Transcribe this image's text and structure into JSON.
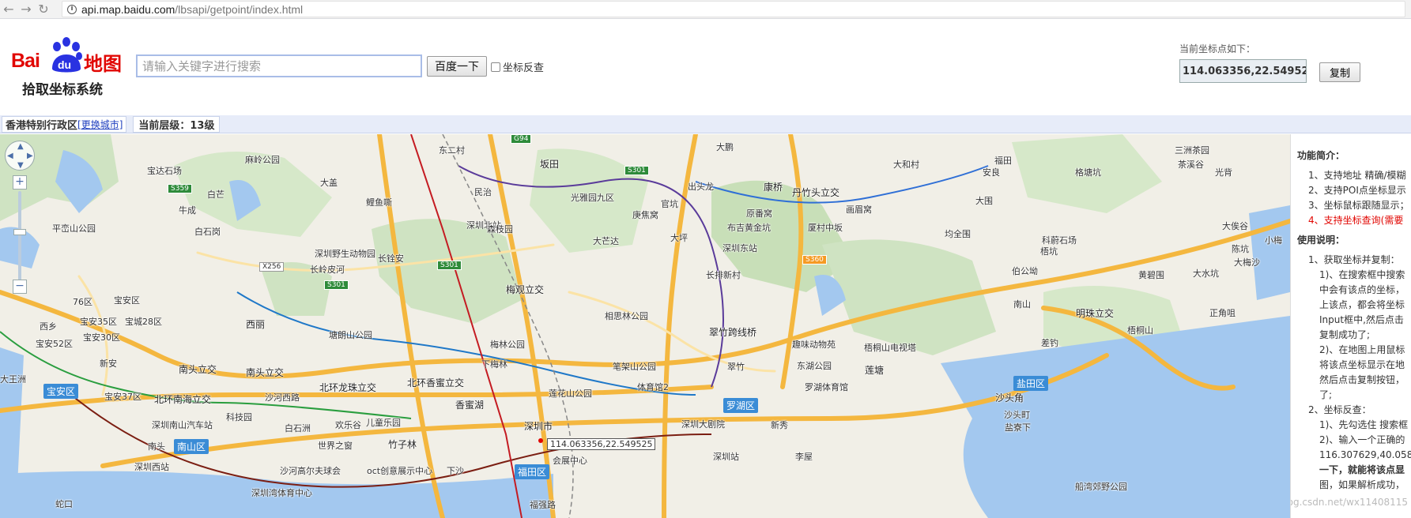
{
  "browser": {
    "url_host": "api.map.baidu.com",
    "url_path": "/lbsapi/getpoint/index.html"
  },
  "header": {
    "logo_text_bai": "Bai",
    "logo_text_du": "du",
    "logo_text_map": "地图",
    "logo_subtitle": "拾取坐标系统",
    "search_placeholder": "请输入关键字进行搜索",
    "search_button": "百度一下",
    "reverse_label": "坐标反查",
    "coord_title": "当前坐标点如下：",
    "coord_value": "114.063356,22.549525",
    "copy_button": "复制"
  },
  "citybar": {
    "city": "香港特别行政区",
    "change_city": "[更换城市]",
    "level": "当前层级：13级"
  },
  "map": {
    "popup_coord": "114.063356,22.549525",
    "districts": [
      "宝安区",
      "南山区",
      "罗湖区",
      "福田区",
      "盐田区"
    ],
    "road_tags": [
      "G94",
      "S301",
      "S359",
      "S301",
      "S301",
      "X256",
      "S360"
    ],
    "labels": [
      "麻岭公园",
      "东二村",
      "坂田",
      "大鹏",
      "福田",
      "三洲茶园",
      "宝达石场",
      "大盖",
      "民治",
      "光雅园九区",
      "出头龙",
      "康桥",
      "丹竹头立交",
      "大和村",
      "安良",
      "格塘坑",
      "光背",
      "茶溪谷",
      "白芒",
      "鲤鱼嘶",
      "深圳北站",
      "官坑",
      "原番窝",
      "画眉窝",
      "大围",
      "牛成",
      "森枝园",
      "庚焦窝",
      "布吉黄金坑",
      "厦村中坂",
      "均全围",
      "大俟谷",
      "平峦山公园",
      "白石岗",
      "大芒达",
      "大坪",
      "深圳东站",
      "科蔚石场",
      "陈坑",
      "小梅",
      "深圳野生动物园",
      "长岭皮河",
      "长铨安",
      "长排新村",
      "梧坑",
      "伯公坳",
      "黄碧围",
      "大水坑",
      "大梅沙",
      "76区",
      "宝安区",
      "梅观立交",
      "南山",
      "正角咀",
      "西丽",
      "相思林公园",
      "塘朗山公园",
      "西乡",
      "宝安35区",
      "宝城28区",
      "宝安30区",
      "翠竹跨线桥",
      "趣味动物苑",
      "梧桐山电视塔",
      "梧桐山",
      "明珠立交",
      "宝安52区",
      "梅林公园",
      "下梅林",
      "笔架山公园",
      "东湖公园",
      "莲塘",
      "差钓",
      "新安",
      "南头立交",
      "南头立交",
      "翠竹",
      "大王洲",
      "宝安37区",
      "北环南海立交",
      "北环龙珠立交",
      "北环香蜜立交",
      "体育馆2",
      "莲花山公园",
      "罗湖体育馆",
      "沙头角",
      "沙头町",
      "盐寮下",
      "深圳南山汽车站",
      "科技园",
      "白石洲",
      "欢乐谷",
      "儿童乐园",
      "香蜜湖",
      "深圳市",
      "深圳大剧院",
      "新秀",
      "南头",
      "世界之窗",
      "竹子林",
      "深圳西站",
      "沙河高尔夫球会",
      "oct创意展示中心",
      "下沙",
      "会展中心",
      "深圳站",
      "李屋",
      "深圳湾体育中心",
      "福强路",
      "船湾郊野公园",
      "蛇口",
      "沙河西路"
    ]
  },
  "panel": {
    "intro_title": "功能简介：",
    "intro_items": [
      "1、支持地址 精确/模糊",
      "2、支持POI点坐标显示",
      "3、坐标鼠标跟随显示；",
      "4、支持坐标查询(需要"
    ],
    "usage_title": "使用说明：",
    "usage_lines": [
      "1、获取坐标并复制：",
      "1)、在搜索框中搜索",
      "中会有该点的坐标，",
      "上该点，都会将坐标",
      "Input框中,然后点击",
      "复制成功了;",
      "2)、在地图上用鼠标",
      "将该点坐标显示在地",
      "然后点击复制按钮，",
      "了;",
      "2、坐标反查：",
      "1)、先勾选住 搜索框",
      "2)、输入一个正确的",
      "116.307629,40.058",
      "一下，就能将该点显",
      "图，如果解析成功，"
    ],
    "watermark": "http://blog.csdn.net/wx11408115"
  }
}
